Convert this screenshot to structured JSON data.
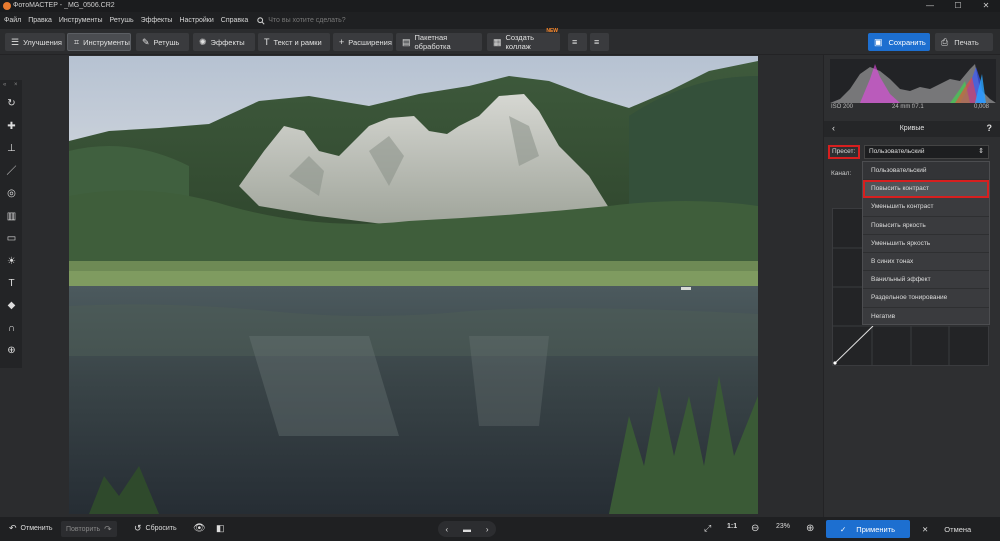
{
  "window": {
    "title": "ФотоМАСТЕР - _MG_0506.CR2",
    "minimize": "—",
    "maximize": "☐",
    "close": "✕"
  },
  "menu": {
    "items": [
      "Файл",
      "Правка",
      "Инструменты",
      "Ретушь",
      "Эффекты",
      "Настройки",
      "Справка"
    ],
    "search_placeholder": "Что вы хотите сделать?"
  },
  "toolbar": {
    "tabs": [
      {
        "label": "Улучшения",
        "icon": "sliders-icon"
      },
      {
        "label": "Инструменты",
        "icon": "crop-icon"
      },
      {
        "label": "Ретушь",
        "icon": "brush-icon"
      },
      {
        "label": "Эффекты",
        "icon": "sparkle-icon"
      },
      {
        "label": "Текст и рамки",
        "icon": "text-icon"
      },
      {
        "label": "Расширения",
        "icon": "plus-icon"
      }
    ],
    "batch_label": "Пакетная обработка",
    "collage_label": "Создать коллаж",
    "collage_badge": "NEW",
    "save_label": "Сохранить",
    "print_label": "Печать"
  },
  "histogram": {
    "iso": "ISO 200",
    "lens": "24 mm f/7.1",
    "exposure": "0,008"
  },
  "curves": {
    "title": "Кривые",
    "preset_label": "Пресет:",
    "preset_value": "Пользовательский",
    "channel_label": "Канал:",
    "options": [
      "Пользовательский",
      "Повысить контраст",
      "Уменьшить контраст",
      "Повысить яркость",
      "Уменьшить яркость",
      "В синих тонах",
      "Ванильный эффект",
      "Раздельное тонирование",
      "Негатив"
    ]
  },
  "bottom": {
    "undo_label": "Отменить",
    "redo_label": "Повторить",
    "reset_label": "Сбросить",
    "ratio": "1:1",
    "zoom": "23%",
    "apply_label": "Применить",
    "cancel_label": "Отмена"
  }
}
